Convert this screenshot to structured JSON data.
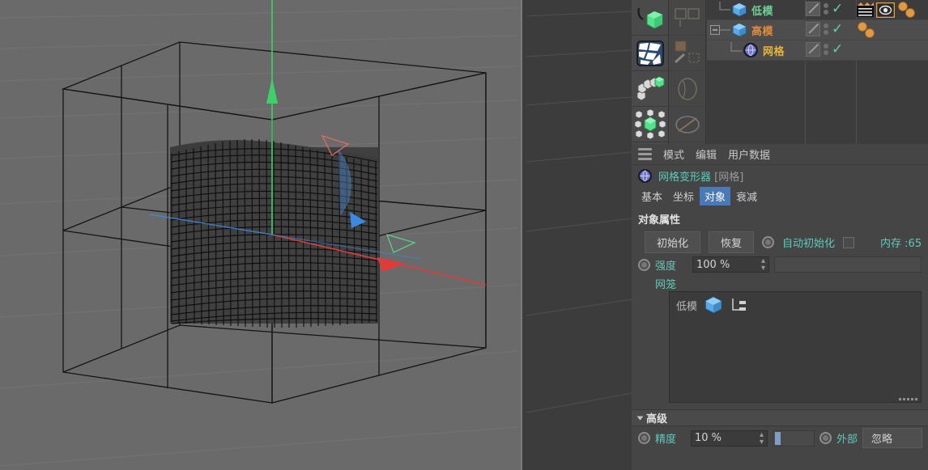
{
  "viewport": {
    "name": "perspective-viewport",
    "background_color": "#6a6a6a",
    "background_dark_color": "#3c3c3c",
    "gizmo": {
      "x_axis_color": "#e03b3b",
      "y_axis_color": "#3fd06a",
      "z_axis_color": "#3b8ae0"
    },
    "cage_wire_color": "#121212",
    "mesh_wire_color": "#0a0a0a"
  },
  "toolbar": {
    "column_left": [
      {
        "name": "magnet-cube-icon",
        "label": "magnet-cube-icon"
      },
      {
        "name": "uv-polygon-icon",
        "label": "uv-polygon-icon"
      },
      {
        "name": "cube-chain-icon",
        "label": "cube-chain-icon"
      },
      {
        "name": "cube-cluster-icon",
        "label": "cube-cluster-icon"
      }
    ],
    "column_right": [
      {
        "name": "tool-icon-1",
        "label": "tool-icon-1"
      },
      {
        "name": "tool-icon-2",
        "label": "tool-icon-2"
      },
      {
        "name": "tool-icon-3",
        "label": "tool-icon-3"
      },
      {
        "name": "tool-icon-4",
        "label": "tool-icon-4"
      }
    ]
  },
  "object_manager": {
    "rows": [
      {
        "label": "低模",
        "color": "#6fcf97",
        "icon": "cube-icon",
        "icon_color": "#5aa9e6",
        "indent": 1,
        "expander": "",
        "selected": false,
        "visible_check": "✓",
        "tags": [
          "film-strip-tag",
          "eye-tag",
          "sphere-tag-1",
          "sphere-tag-2"
        ]
      },
      {
        "label": "高模",
        "color": "#e08b3f",
        "icon": "cube-icon",
        "icon_color": "#5aa9e6",
        "indent": 1,
        "expander": "-",
        "selected": true,
        "visible_check": "✓",
        "tags": [
          "sphere-tag-1",
          "sphere-tag-2"
        ]
      },
      {
        "label": "网格",
        "color": "#e8b53a",
        "icon": "mesh-deformer-icon",
        "icon_color": "#7b7fd4",
        "indent": 2,
        "expander": "",
        "selected": true,
        "visible_check": "✓",
        "tags": []
      }
    ]
  },
  "attribute_manager": {
    "menu": [
      "模式",
      "编辑",
      "用户数据"
    ],
    "hamburger_icon": "hamburger-menu-icon",
    "title": "网格变形器",
    "title_bracket": "[网格]",
    "title_icon": "mesh-deformer-icon",
    "tabs": [
      {
        "label": "基本",
        "active": false
      },
      {
        "label": "坐标",
        "active": false
      },
      {
        "label": "对象",
        "active": true
      },
      {
        "label": "衰减",
        "active": false
      }
    ],
    "object_properties": {
      "section_title": "对象属性",
      "init_button": "初始化",
      "restore_button": "恢复",
      "auto_init_label": "自动初始化",
      "auto_init_checked": false,
      "memory_label": "内存 :65",
      "strength_label": "强度",
      "strength_value": "100 %",
      "cage_label": "网笼",
      "cage_item": "低模",
      "cage_item_icon": "cube-icon",
      "cage_link_icon": "hierarchy-link-icon"
    },
    "advanced": {
      "section_title": "高级",
      "expanded": true,
      "accuracy_label": "精度",
      "accuracy_value": "10 %",
      "external_label": "外部",
      "external_value": "忽略"
    }
  }
}
